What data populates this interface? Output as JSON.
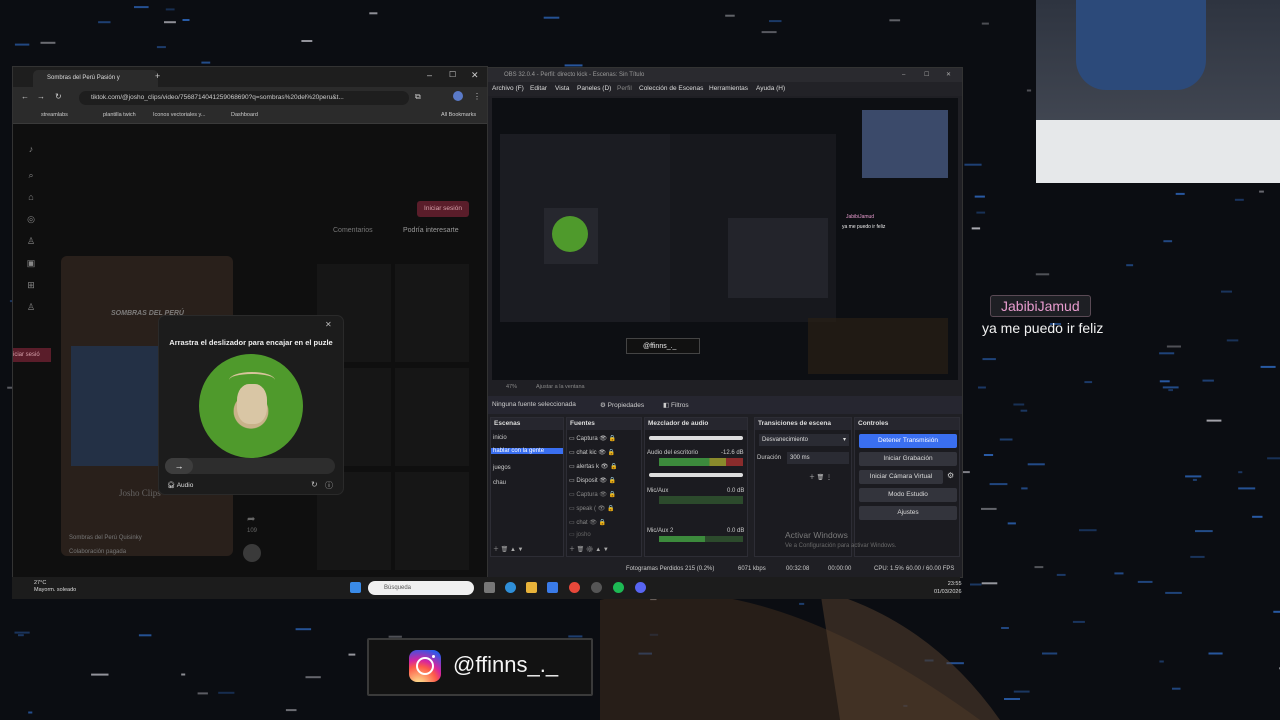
{
  "browser": {
    "tab_title": "Sombras del Perú Pasión y",
    "url": "tiktok.com/@josho_clips/video/7568714041259068690?q=sombras%20del%20peru&t...",
    "bookmarks": [
      "streamlabs",
      "plantilla twich",
      "Iconos vectoriales y...",
      "Dashboard"
    ],
    "all_bookmarks": "All Bookmarks"
  },
  "tiktok": {
    "login_button": "Iniciar sesión",
    "tabs": [
      "Comentarios",
      "Podría interesarte"
    ],
    "video_overlay_text": "SOMBRAS DEL PERÚ",
    "video_author": "Josho Clips",
    "video_desc": "Sombras del Perú Quisinky",
    "video_playlist": "Colaboración pagada",
    "likes": "109",
    "side_login": "iciar sesió"
  },
  "captcha": {
    "title": "Arrastra el deslizador para encajar en el puzle",
    "slider_arrow": "→",
    "audio_label": "Audio"
  },
  "obs": {
    "title": "OBS 32.0.4 - Perfil: directo kick - Escenas: Sin Título",
    "menu": [
      "Archivo (F)",
      "Editar",
      "Vista",
      "Paneles (D)",
      "Perfil",
      "Colección de Escenas",
      "Herramientas",
      "Ayuda (H)"
    ],
    "zoom": "47%",
    "fit_label": "Ajustar a la ventana",
    "no_source": "Ninguna fuente seleccionada",
    "properties": "Propiedades",
    "filters": "Filtros",
    "docks": {
      "scenes_title": "Escenas",
      "scenes": [
        "inicio",
        "hablar con la gente",
        "juegos",
        "chau"
      ],
      "selected_scene": "hablar con la gente",
      "sources_title": "Fuentes",
      "sources": [
        "Captura",
        "chat kic",
        "alertas k",
        "Disposit",
        "Captura",
        "speak (",
        "chat",
        "josho"
      ],
      "mixer_title": "Mezclador de audio",
      "mixer": [
        {
          "name": "Audio del escritorio",
          "db": "-12.6 dB"
        },
        {
          "name": "Mic/Aux",
          "db": "0.0 dB"
        },
        {
          "name": "Mic/Aux 2",
          "db": "0.0 dB"
        }
      ],
      "transitions_title": "Transiciones de escena",
      "transition": "Desvanecimiento",
      "duration_label": "Duración",
      "duration_value": "300 ms",
      "controls_title": "Controles",
      "controls": [
        "Detener Transmisión",
        "Iniciar Grabación",
        "Iniciar Cámara Virtual",
        "Modo Estudio",
        "Ajustes"
      ]
    },
    "activate": "Activar Windows",
    "activate_sub": "Ve a Configuración para activar Windows.",
    "status": {
      "dropped": "Fotogramas Perdidos 215 (0.2%)",
      "bitrate": "6071 kbps",
      "time1": "00:32:08",
      "time2": "00:00:00",
      "cpu": "CPU: 1.5%",
      "fps": "60.00 / 60.00 FPS"
    },
    "preview_chat_name": "JabibiJamud",
    "preview_chat_msg": "ya me puedo ir feliz",
    "preview_ig": "@ffinns_._"
  },
  "taskbar": {
    "temp": "27°C",
    "weather": "Mayorm. soleado",
    "search_placeholder": "Búsqueda",
    "time": "23:55",
    "date": "01/03/2026"
  },
  "chat": {
    "username": "JabibiJamud",
    "message": "ya me puedo ir feliz"
  },
  "instagram": {
    "handle": "@ffinns_._"
  },
  "colors": {
    "accent_blue": "#3a6ff0",
    "chat_name": "#e89ccf",
    "tiktok_login": "#5a1d2a"
  }
}
